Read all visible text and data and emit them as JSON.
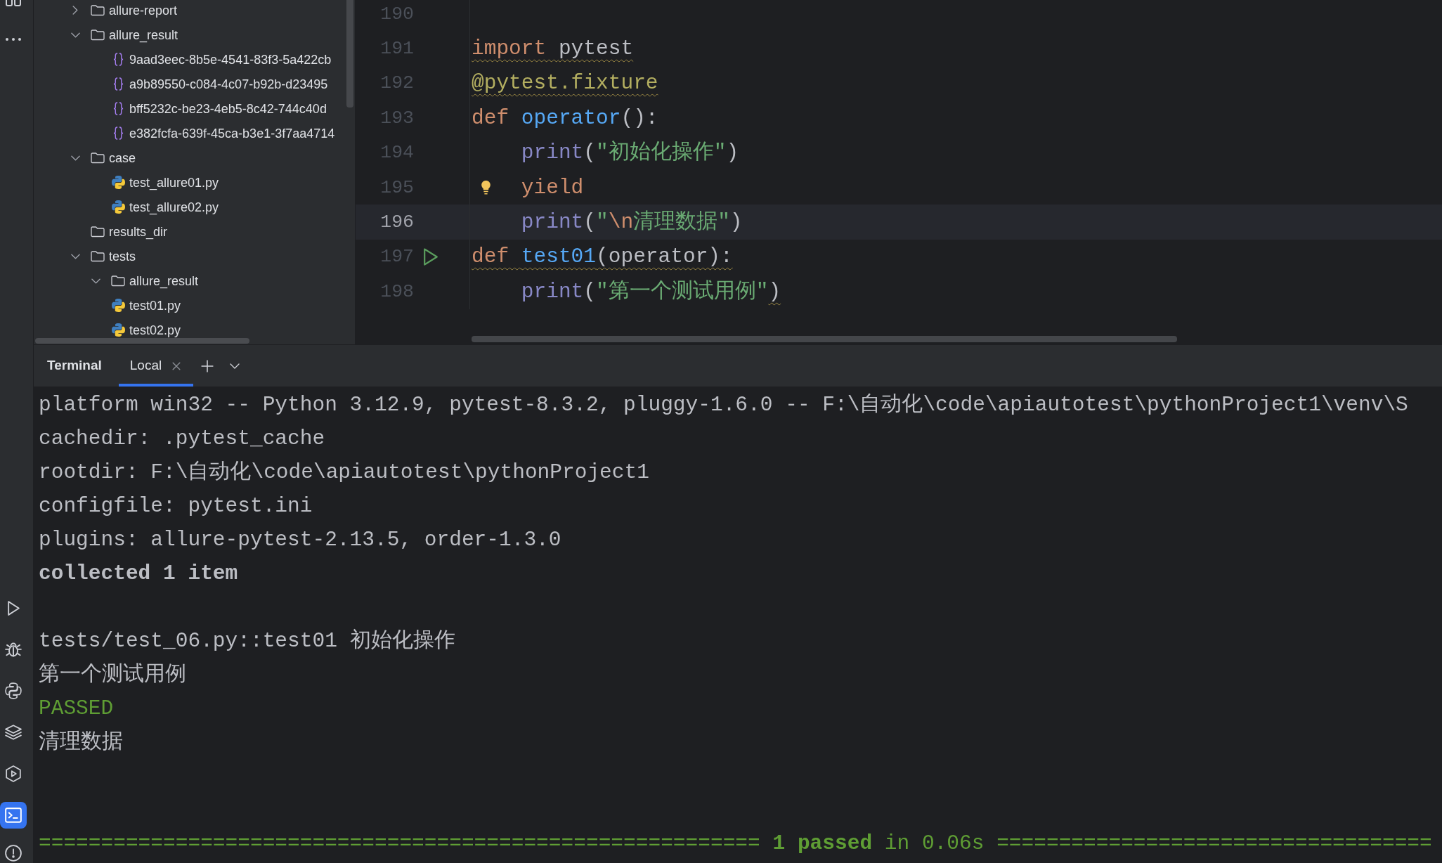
{
  "tool_strip": {
    "top_buttons": [
      {
        "selected": false
      },
      {
        "selected": false
      }
    ],
    "bottom_buttons": [
      {
        "selected": false
      },
      {
        "selected": false
      },
      {
        "selected": false
      },
      {
        "selected": false
      },
      {
        "selected": false
      },
      {
        "selected": true
      },
      {
        "selected": false
      }
    ]
  },
  "project_tree": {
    "items": [
      {
        "name": "allure-report",
        "kind": "folder",
        "expanded": false
      },
      {
        "name": "allure_result",
        "kind": "folder",
        "expanded": true,
        "children": [
          {
            "name": "9aad3eec-8b5e-4541-83f3-5a422cb",
            "kind": "json"
          },
          {
            "name": "a9b89550-c084-4c07-b92b-d23495",
            "kind": "json"
          },
          {
            "name": "bff5232c-be23-4eb5-8c42-744c40d",
            "kind": "json"
          },
          {
            "name": "e382fcfa-639f-45ca-b3e1-3f7aa4714",
            "kind": "json"
          }
        ]
      },
      {
        "name": "case",
        "kind": "folder",
        "expanded": true,
        "children": [
          {
            "name": "test_allure01.py",
            "kind": "python"
          },
          {
            "name": "test_allure02.py",
            "kind": "python"
          }
        ]
      },
      {
        "name": "results_dir",
        "kind": "folder"
      },
      {
        "name": "tests",
        "kind": "folder",
        "expanded": true,
        "children": [
          {
            "name": "allure_result",
            "kind": "folder",
            "expanded": true
          },
          {
            "name": "test01.py",
            "kind": "python"
          },
          {
            "name": "test02.py",
            "kind": "python"
          }
        ]
      }
    ]
  },
  "editor": {
    "lines": [
      {
        "number": "190",
        "current": false,
        "hint": false,
        "runnable": false
      },
      {
        "number": "191",
        "current": false,
        "hint": false,
        "runnable": false,
        "tokens": [
          {
            "text": "import ",
            "kind": "keyword",
            "warning": true
          },
          {
            "text": "pytest",
            "kind": "plain",
            "warning": true
          }
        ]
      },
      {
        "number": "192",
        "current": false,
        "hint": false,
        "runnable": false,
        "tokens": [
          {
            "text": "@pytest.fixture",
            "kind": "decorator",
            "warning": true
          }
        ]
      },
      {
        "number": "193",
        "current": false,
        "hint": false,
        "runnable": false,
        "tokens": [
          {
            "text": "def ",
            "kind": "keyword",
            "warning": false
          },
          {
            "text": "operator",
            "kind": "function",
            "warning": false
          },
          {
            "text": "():",
            "kind": "plain",
            "warning": false
          }
        ],
        "children": [
          {
            "number": "194",
            "current": false,
            "hint": false,
            "runnable": false,
            "tokens": [
              {
                "text": "print",
                "kind": "builtin",
                "warning": false
              },
              {
                "text": "(",
                "kind": "plain",
                "warning": false
              },
              {
                "text": "\"初始化操作\"",
                "kind": "string",
                "warning": false
              },
              {
                "text": ")",
                "kind": "plain",
                "warning": false
              }
            ]
          },
          {
            "number": "195",
            "current": false,
            "hint": true,
            "runnable": false,
            "tokens": [
              {
                "text": "yield",
                "kind": "keyword",
                "warning": false
              }
            ]
          },
          {
            "number": "196",
            "current": true,
            "hint": false,
            "runnable": false,
            "tokens": [
              {
                "text": "print",
                "kind": "builtin",
                "warning": false
              },
              {
                "text": "(",
                "kind": "plain",
                "warning": false
              },
              {
                "text": "\"",
                "kind": "string",
                "warning": false
              },
              {
                "text": "\\n",
                "kind": "escape",
                "warning": false
              },
              {
                "text": "清理数据\"",
                "kind": "string",
                "warning": false
              },
              {
                "text": ")",
                "kind": "plain",
                "warning": false
              }
            ]
          }
        ]
      },
      {
        "number": "197",
        "current": false,
        "hint": false,
        "runnable": true,
        "tokens": [
          {
            "text": "def ",
            "kind": "keyword",
            "warning": true
          },
          {
            "text": "test01",
            "kind": "function",
            "warning": true
          },
          {
            "text": "(operator):",
            "kind": "plain",
            "warning": true
          }
        ],
        "children": [
          {
            "number": "198",
            "current": false,
            "hint": false,
            "runnable": false,
            "tokens": [
              {
                "text": "print",
                "kind": "builtin",
                "warning": false
              },
              {
                "text": "(",
                "kind": "plain",
                "warning": false
              },
              {
                "text": "\"第一个测试用例\"",
                "kind": "string",
                "warning": false
              },
              {
                "text": ")",
                "kind": "plain",
                "warning": true
              }
            ]
          }
        ]
      }
    ]
  },
  "terminal": {
    "title": "Terminal",
    "tabs": [
      {
        "label": "Local",
        "selected": true
      }
    ],
    "lines": [
      {
        "kind": "text",
        "text": "platform win32 -- Python 3.12.9, pytest-8.3.2, pluggy-1.6.0 -- F:\\自动化\\code\\apiautotest\\pythonProject1\\venv\\S"
      },
      {
        "kind": "text",
        "text": "cachedir: .pytest_cache"
      },
      {
        "kind": "text",
        "text": "rootdir: F:\\自动化\\code\\apiautotest\\pythonProject1"
      },
      {
        "kind": "text",
        "text": "configfile: pytest.ini"
      },
      {
        "kind": "text",
        "text": "plugins: allure-pytest-2.13.5, order-1.3.0"
      },
      {
        "kind": "bold",
        "text": "collected 1 item"
      },
      {
        "kind": "blank"
      },
      {
        "kind": "text",
        "text": "tests/test_06.py::test01 初始化操作"
      },
      {
        "kind": "text",
        "text": "第一个测试用例"
      },
      {
        "kind": "success",
        "text": "PASSED"
      },
      {
        "kind": "text",
        "text": "清理数据"
      },
      {
        "kind": "blank"
      },
      {
        "kind": "blank"
      },
      {
        "kind": "summary",
        "text": "========================================================== **1 passed** in 0.06s ==================================="
      }
    ]
  }
}
